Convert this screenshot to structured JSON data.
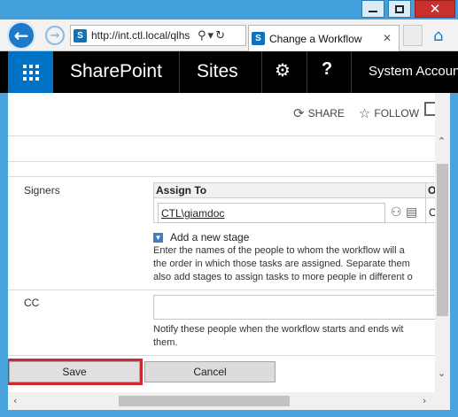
{
  "browser": {
    "url": "http://int.ctl.local/qlhs",
    "tab_title": "Change a Workflow",
    "back_glyph": "←",
    "forward_glyph": "→",
    "search_glyph": "⚲",
    "refresh_glyph": "↻",
    "tab_close_glyph": "✕",
    "home_glyph": "⌂",
    "favicon_letter": "S"
  },
  "window": {
    "close_glyph": "✕"
  },
  "suitebar": {
    "brand": "SharePoint",
    "sites": "Sites",
    "gear_glyph": "⚙",
    "help": "?",
    "account": "System Account"
  },
  "page_actions": {
    "share": "SHARE",
    "follow": "FOLLOW",
    "share_glyph": "⟳",
    "follow_glyph": "☆"
  },
  "form": {
    "signers_label": "Signers",
    "assign_header": "Assign To",
    "order_header": "Or",
    "assignee": "CTL\\giamdoc",
    "order_cell": "O",
    "people_icons": "⚇ ▤",
    "add_stage": "Add a new stage",
    "signers_help": [
      "Enter the names of the people to whom the workflow will a",
      "the order in which those tasks are assigned. Separate them",
      "also add stages to assign tasks to more people in different o"
    ],
    "cc_label": "CC",
    "cc_value": "",
    "cc_help": [
      "Notify these people when the workflow starts and ends wit",
      "them."
    ],
    "save_label": "Save",
    "cancel_label": "Cancel"
  },
  "scroll": {
    "up": "⌃",
    "down": "⌄"
  },
  "colors": {
    "suitebar": "#000000",
    "waffle": "#0072c6",
    "frame": "#4aa3dd",
    "save_highlight": "#d0262d"
  }
}
